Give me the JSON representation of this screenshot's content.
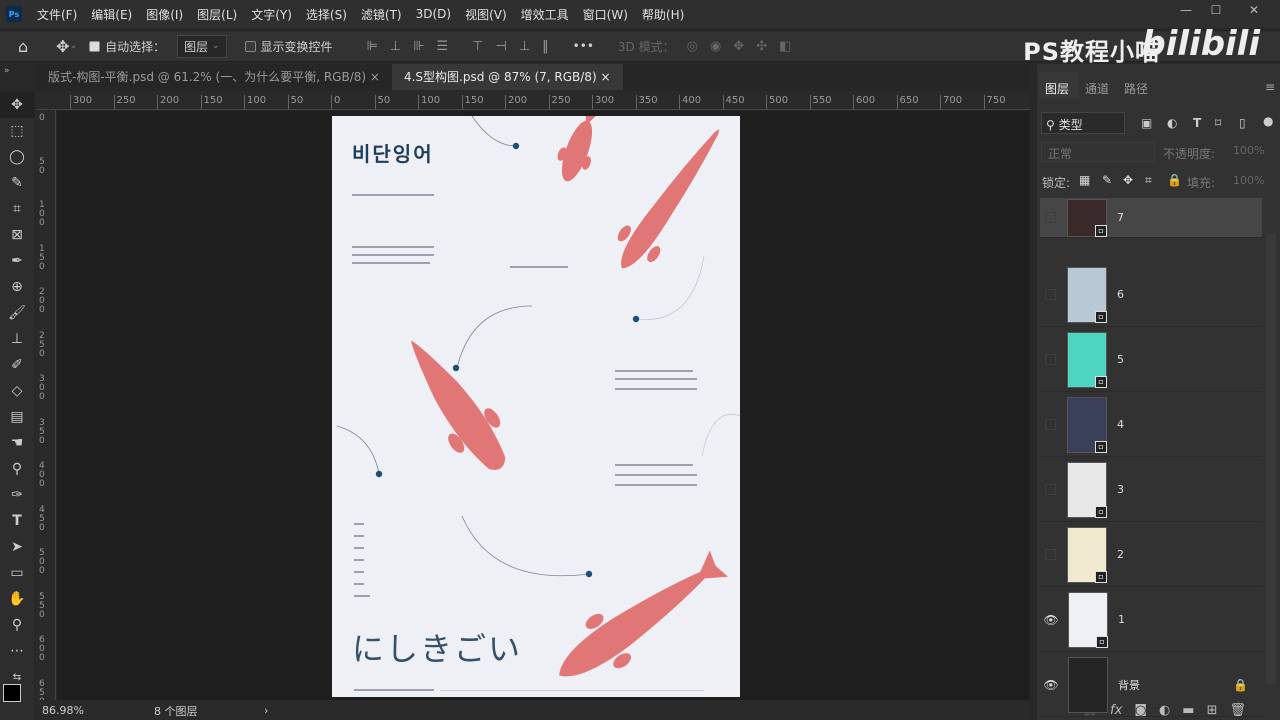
{
  "app": {
    "logo": "Ps"
  },
  "menu": [
    "文件(F)",
    "编辑(E)",
    "图像(I)",
    "图层(L)",
    "文字(Y)",
    "选择(S)",
    "滤镜(T)",
    "3D(D)",
    "视图(V)",
    "增效工具",
    "窗口(W)",
    "帮助(H)"
  ],
  "window_controls": {
    "minimize": "—",
    "maximize": "☐",
    "close": "✕"
  },
  "options": {
    "auto_select_label": "自动选择：",
    "auto_select_checked": true,
    "auto_select_target": "图层",
    "show_transform_label": "显示变换控件",
    "show_transform_checked": false,
    "more": "•••",
    "mode_3d_label": "3D 模式："
  },
  "watermark": {
    "channel": "PS教程小喵",
    "site": "bilibili"
  },
  "tabs": [
    {
      "label": "版式-构图-平衡.psd @ 61.2% (一、为什么要平衡, RGB/8)",
      "close": "×",
      "active": false
    },
    {
      "label": "4.S型构图.psd @ 87% (7, RGB/8)",
      "close": "×",
      "active": true
    }
  ],
  "rulers": {
    "top": [
      "300",
      "250",
      "200",
      "150",
      "100",
      "50",
      "0",
      "50",
      "100",
      "150",
      "200",
      "250",
      "300",
      "350",
      "400",
      "450",
      "500",
      "550",
      "600",
      "650",
      "700",
      "750"
    ],
    "left": [
      "0",
      "50",
      "100",
      "150",
      "200",
      "250",
      "300",
      "350",
      "400",
      "450",
      "500",
      "550",
      "600",
      "650"
    ]
  },
  "poster": {
    "title_korean": "비단잉어",
    "title_japanese": "にしきごい",
    "fish_color": "#e06b6b",
    "dot_color": "#1f4e7a"
  },
  "status": {
    "zoom": "86.98%",
    "info": "8 个图层",
    "arrow": "›"
  },
  "panel": {
    "tabs": [
      "图层",
      "通道",
      "路径"
    ],
    "filter_label": "类型",
    "blend_mode": "正常",
    "opacity_label": "不透明度:",
    "opacity": "100%",
    "lock_label": "锁定:",
    "fill_label": "填充:",
    "fill": "100%",
    "layers": [
      {
        "name": "7",
        "visible": false,
        "selected": true,
        "thumb": "#3a2a2a"
      },
      {
        "name": "6",
        "visible": false,
        "selected": false,
        "thumb": "#b8c8d4"
      },
      {
        "name": "5",
        "visible": false,
        "selected": false,
        "thumb": "#4fd6c0"
      },
      {
        "name": "4",
        "visible": false,
        "selected": false,
        "thumb": "#3a3f5a"
      },
      {
        "name": "3",
        "visible": false,
        "selected": false,
        "thumb": "#e8e8e8"
      },
      {
        "name": "2",
        "visible": false,
        "selected": false,
        "thumb": "#f2ead0"
      },
      {
        "name": "1",
        "visible": true,
        "selected": false,
        "thumb": "#eef0f6"
      },
      {
        "name": "背景",
        "visible": true,
        "selected": false,
        "thumb": "#252525",
        "locked": true
      }
    ]
  }
}
